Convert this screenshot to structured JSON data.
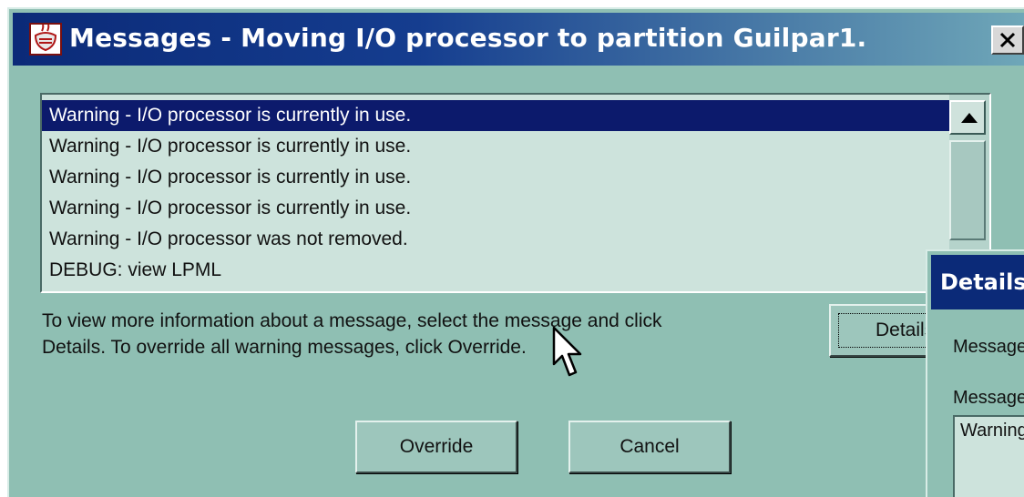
{
  "window": {
    "title": "Messages - Moving I/O processor to partition Guilpar1.",
    "close_label": "X"
  },
  "messages": [
    "Warning - I/O processor is currently in use.",
    "Warning - I/O processor is currently in use.",
    "Warning - I/O processor is currently in use.",
    "Warning - I/O processor is currently in use.",
    "Warning - I/O processor was not removed.",
    "DEBUG: view LPML"
  ],
  "selected_index": 0,
  "instructions": {
    "line1": "To view more information about a message, select the message and click",
    "line2": "Details.  To override all warning messages, click Override."
  },
  "buttons": {
    "details": "Details",
    "override": "Override",
    "cancel": "Cancel"
  },
  "details_window": {
    "title": "Details",
    "label1": "Message",
    "label2": "Message",
    "text_value": "Warning"
  },
  "icons": {
    "app": "java-app-icon",
    "close": "close-icon",
    "scroll_up": "scroll-up-arrow-icon",
    "cursor": "mouse-pointer-icon"
  },
  "colors": {
    "dialog_bg": "#8fbfb3",
    "title_bar": "#0b2a78",
    "list_bg": "#cde3dc",
    "selection": "#0c1a6c"
  }
}
